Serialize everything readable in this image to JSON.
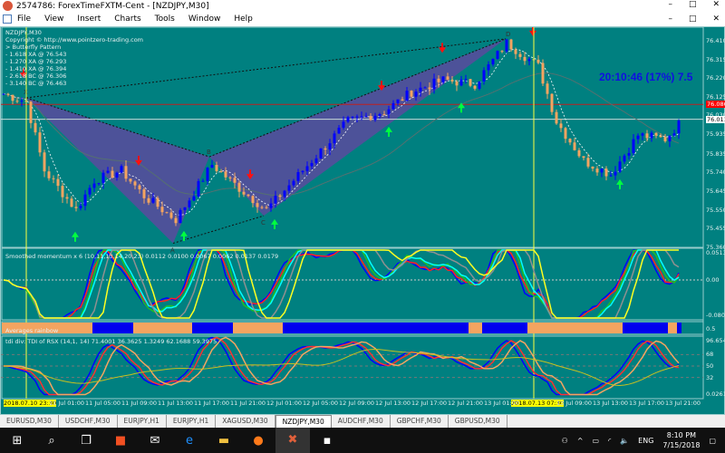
{
  "window": {
    "title": "2574786: ForexTimeFXTM-Cent - [NZDJPY,M30]",
    "min": "–",
    "max": "□",
    "close": "✕"
  },
  "menu": [
    "File",
    "View",
    "Insert",
    "Charts",
    "Tools",
    "Window",
    "Help"
  ],
  "chart": {
    "symbol": "NZDJPY,M30",
    "info": [
      "Copyright © http://www.pointzero-trading.com",
      "> Butterfly Pattern",
      "- 1.618 XA @ 76.543",
      "- 1.270 XA @ 76.293",
      "- 1.410 XA @ 76.394",
      "- 2.618 BC @ 76.306",
      "- 3.140 BC @ 76.463"
    ],
    "clock": "20:10:46 (17%) 7.5",
    "pattern_points": {
      "X": "X",
      "A": "A",
      "B": "B",
      "C": "C",
      "D": "D"
    },
    "price_axis": [
      "76.410",
      "76.315",
      "76.220",
      "76.125",
      "76.030",
      "75.935",
      "75.835",
      "75.740",
      "75.645",
      "75.550",
      "75.455",
      "75.360"
    ],
    "bid_label": "76.086",
    "ask_label": "76.011",
    "colors": {
      "bg": "#008080",
      "bull": "#0000ff",
      "bear": "#f4a460",
      "pattern": "#5b4a9e",
      "sell": "#ff1010",
      "buy": "#00ff40"
    },
    "price_path": [
      [
        0,
        76.14
      ],
      [
        5,
        76.1
      ],
      [
        9,
        75.75
      ],
      [
        16,
        75.55
      ],
      [
        20,
        75.7
      ],
      [
        26,
        75.75
      ],
      [
        31,
        75.62
      ],
      [
        38,
        75.5
      ],
      [
        46,
        75.78
      ],
      [
        52,
        75.66
      ],
      [
        58,
        75.55
      ],
      [
        66,
        75.75
      ],
      [
        76,
        76.0
      ],
      [
        84,
        76.05
      ],
      [
        90,
        76.15
      ],
      [
        97,
        76.21
      ],
      [
        104,
        76.19
      ],
      [
        111,
        76.4
      ],
      [
        118,
        76.28
      ],
      [
        122,
        76.0
      ],
      [
        128,
        75.8
      ],
      [
        134,
        75.73
      ],
      [
        140,
        75.93
      ],
      [
        146,
        75.91
      ],
      [
        150,
        76.01
      ]
    ]
  },
  "momentum": {
    "title": "Smoothed momentum x 6 (10,11,13,14,20,23) 0.0112 0.0100 0.0067 0.0062 0.0137 0.0179",
    "axis": [
      "0.0513",
      "0.00",
      "-0.0809"
    ]
  },
  "rainbow": {
    "title": "Averages rainbow",
    "axis": "0.5"
  },
  "tdi": {
    "title": "tdi div: TDI of RSX  (14,1, 14) 71.4001 36.3625 1.3249 62.1688 59.3975",
    "axis": [
      "96.6542",
      "68",
      "50",
      "32",
      "0.0261"
    ]
  },
  "time_axis": {
    "highlight1": "2018.07.10 23:30",
    "highlight2": "2018.07.13 07:30",
    "labels": [
      "11 Jul 01:00",
      "11 Jul 05:00",
      "11 Jul 09:00",
      "11 Jul 13:00",
      "11 Jul 17:00",
      "11 Jul 21:00",
      "12 Jul 01:00",
      "12 Jul 05:00",
      "12 Jul 09:00",
      "12 Jul 13:00",
      "12 Jul 17:00",
      "12 Jul 21:00",
      "13 Jul 01:00",
      "13 Jul 05:00",
      "13 Jul 09:00",
      "13 Jul 13:00",
      "13 Jul 17:00",
      "13 Jul 21:00"
    ]
  },
  "tabs": [
    "EURUSD,M30",
    "USDCHF,M30",
    "EURJPY,H1",
    "EURJPY,H1",
    "XAGUSD,M30",
    "NZDJPY,M30",
    "AUDCHF,M30",
    "GBPCHF,M30",
    "GBPUSD,M30"
  ],
  "active_tab": "NZDJPY,M30",
  "tray": {
    "lang": "ENG",
    "time": "8:10 PM",
    "date": "7/15/2018"
  }
}
